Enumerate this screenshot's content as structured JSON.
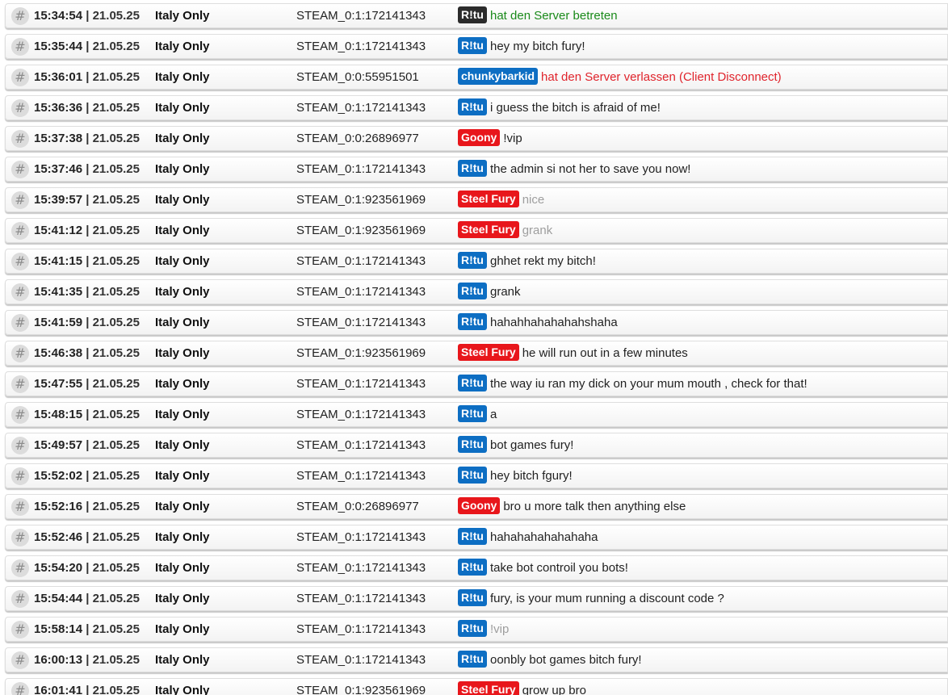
{
  "colors": {
    "badge_dark": "#2b2b2b",
    "badge_blue": "#0d6ec3",
    "badge_red": "#e8161b",
    "msg_normal": "#222222",
    "msg_join": "#1a8a1a",
    "msg_leave": "#e0242c",
    "msg_muted": "#9e9e9e"
  },
  "rows": [
    {
      "hash": "#",
      "time": "15:34:54",
      "sep": "|",
      "date": "21.05.25",
      "server": "Italy Only",
      "steam": "STEAM_0:1:172141343",
      "name": "R!tu",
      "badge": "dark",
      "text": "hat den Server betreten",
      "style": "join"
    },
    {
      "hash": "#",
      "time": "15:35:44",
      "sep": "|",
      "date": "21.05.25",
      "server": "Italy Only",
      "steam": "STEAM_0:1:172141343",
      "name": "R!tu",
      "badge": "blue",
      "text": "hey my bitch fury!",
      "style": "normal"
    },
    {
      "hash": "#",
      "time": "15:36:01",
      "sep": "|",
      "date": "21.05.25",
      "server": "Italy Only",
      "steam": "STEAM_0:0:55951501",
      "name": "chunkybarkid",
      "badge": "blue",
      "text": "hat den Server verlassen (Client Disconnect)",
      "style": "leave"
    },
    {
      "hash": "#",
      "time": "15:36:36",
      "sep": "|",
      "date": "21.05.25",
      "server": "Italy Only",
      "steam": "STEAM_0:1:172141343",
      "name": "R!tu",
      "badge": "blue",
      "text": "i guess the bitch is afraid of me!",
      "style": "normal"
    },
    {
      "hash": "#",
      "time": "15:37:38",
      "sep": "|",
      "date": "21.05.25",
      "server": "Italy Only",
      "steam": "STEAM_0:0:26896977",
      "name": "Goony",
      "badge": "red",
      "text": "!vip",
      "style": "normal"
    },
    {
      "hash": "#",
      "time": "15:37:46",
      "sep": "|",
      "date": "21.05.25",
      "server": "Italy Only",
      "steam": "STEAM_0:1:172141343",
      "name": "R!tu",
      "badge": "blue",
      "text": "the admin si not her to save you now!",
      "style": "normal"
    },
    {
      "hash": "#",
      "time": "15:39:57",
      "sep": "|",
      "date": "21.05.25",
      "server": "Italy Only",
      "steam": "STEAM_0:1:923561969",
      "name": "Steel Fury",
      "badge": "red",
      "text": "nice",
      "style": "muted"
    },
    {
      "hash": "#",
      "time": "15:41:12",
      "sep": "|",
      "date": "21.05.25",
      "server": "Italy Only",
      "steam": "STEAM_0:1:923561969",
      "name": "Steel Fury",
      "badge": "red",
      "text": "grank",
      "style": "muted"
    },
    {
      "hash": "#",
      "time": "15:41:15",
      "sep": "|",
      "date": "21.05.25",
      "server": "Italy Only",
      "steam": "STEAM_0:1:172141343",
      "name": "R!tu",
      "badge": "blue",
      "text": "ghhet rekt my bitch!",
      "style": "normal"
    },
    {
      "hash": "#",
      "time": "15:41:35",
      "sep": "|",
      "date": "21.05.25",
      "server": "Italy Only",
      "steam": "STEAM_0:1:172141343",
      "name": "R!tu",
      "badge": "blue",
      "text": "grank",
      "style": "normal"
    },
    {
      "hash": "#",
      "time": "15:41:59",
      "sep": "|",
      "date": "21.05.25",
      "server": "Italy Only",
      "steam": "STEAM_0:1:172141343",
      "name": "R!tu",
      "badge": "blue",
      "text": "hahahhahahahahshaha",
      "style": "normal"
    },
    {
      "hash": "#",
      "time": "15:46:38",
      "sep": "|",
      "date": "21.05.25",
      "server": "Italy Only",
      "steam": "STEAM_0:1:923561969",
      "name": "Steel Fury",
      "badge": "red",
      "text": "he will run out in a few minutes",
      "style": "normal"
    },
    {
      "hash": "#",
      "time": "15:47:55",
      "sep": "|",
      "date": "21.05.25",
      "server": "Italy Only",
      "steam": "STEAM_0:1:172141343",
      "name": "R!tu",
      "badge": "blue",
      "text": "the way iu ran my dick on your mum mouth , check for that!",
      "style": "normal"
    },
    {
      "hash": "#",
      "time": "15:48:15",
      "sep": "|",
      "date": "21.05.25",
      "server": "Italy Only",
      "steam": "STEAM_0:1:172141343",
      "name": "R!tu",
      "badge": "blue",
      "text": "a",
      "style": "normal"
    },
    {
      "hash": "#",
      "time": "15:49:57",
      "sep": "|",
      "date": "21.05.25",
      "server": "Italy Only",
      "steam": "STEAM_0:1:172141343",
      "name": "R!tu",
      "badge": "blue",
      "text": "bot games fury!",
      "style": "normal"
    },
    {
      "hash": "#",
      "time": "15:52:02",
      "sep": "|",
      "date": "21.05.25",
      "server": "Italy Only",
      "steam": "STEAM_0:1:172141343",
      "name": "R!tu",
      "badge": "blue",
      "text": "hey bitch fgury!",
      "style": "normal"
    },
    {
      "hash": "#",
      "time": "15:52:16",
      "sep": "|",
      "date": "21.05.25",
      "server": "Italy Only",
      "steam": "STEAM_0:0:26896977",
      "name": "Goony",
      "badge": "red",
      "text": "bro u more talk then anything else",
      "style": "normal"
    },
    {
      "hash": "#",
      "time": "15:52:46",
      "sep": "|",
      "date": "21.05.25",
      "server": "Italy Only",
      "steam": "STEAM_0:1:172141343",
      "name": "R!tu",
      "badge": "blue",
      "text": "hahahahahahahaha",
      "style": "normal"
    },
    {
      "hash": "#",
      "time": "15:54:20",
      "sep": "|",
      "date": "21.05.25",
      "server": "Italy Only",
      "steam": "STEAM_0:1:172141343",
      "name": "R!tu",
      "badge": "blue",
      "text": "take bot controil you bots!",
      "style": "normal"
    },
    {
      "hash": "#",
      "time": "15:54:44",
      "sep": "|",
      "date": "21.05.25",
      "server": "Italy Only",
      "steam": "STEAM_0:1:172141343",
      "name": "R!tu",
      "badge": "blue",
      "text": "fury, is your mum running a discount code ?",
      "style": "normal"
    },
    {
      "hash": "#",
      "time": "15:58:14",
      "sep": "|",
      "date": "21.05.25",
      "server": "Italy Only",
      "steam": "STEAM_0:1:172141343",
      "name": "R!tu",
      "badge": "blue",
      "text": "!vip",
      "style": "muted"
    },
    {
      "hash": "#",
      "time": "16:00:13",
      "sep": "|",
      "date": "21.05.25",
      "server": "Italy Only",
      "steam": "STEAM_0:1:172141343",
      "name": "R!tu",
      "badge": "blue",
      "text": "oonbly bot games bitch fury!",
      "style": "normal"
    },
    {
      "hash": "#",
      "time": "16:01:41",
      "sep": "|",
      "date": "21.05.25",
      "server": "Italy Only",
      "steam": "STEAM_0:1:923561969",
      "name": "Steel Fury",
      "badge": "red",
      "text": "grow up bro",
      "style": "normal"
    }
  ]
}
